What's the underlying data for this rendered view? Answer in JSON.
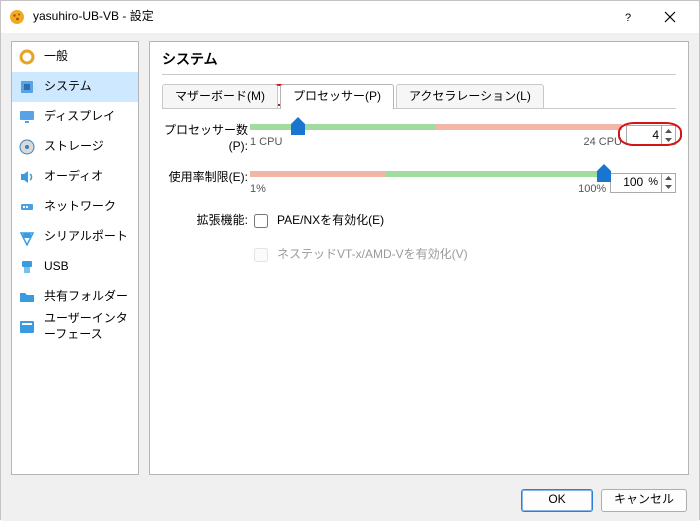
{
  "window": {
    "title": "yasuhiro-UB-VB - 設定"
  },
  "nav": {
    "items": [
      {
        "label": "一般",
        "icon": "gear"
      },
      {
        "label": "システム",
        "icon": "chip",
        "selected": true
      },
      {
        "label": "ディスプレイ",
        "icon": "monitor"
      },
      {
        "label": "ストレージ",
        "icon": "disk"
      },
      {
        "label": "オーディオ",
        "icon": "speaker"
      },
      {
        "label": "ネットワーク",
        "icon": "network"
      },
      {
        "label": "シリアルポート",
        "icon": "serial"
      },
      {
        "label": "USB",
        "icon": "usb"
      },
      {
        "label": "共有フォルダー",
        "icon": "folder"
      },
      {
        "label": "ユーザーインターフェース",
        "icon": "ui"
      }
    ]
  },
  "panel": {
    "title": "システム",
    "tabs": [
      {
        "label": "マザーボード(M)"
      },
      {
        "label": "プロセッサー(P)",
        "selected": true,
        "circled": true
      },
      {
        "label": "アクセラレーション(L)"
      }
    ],
    "rows": {
      "cpu_count": {
        "label": "プロセッサー数(P):",
        "min_label": "1 CPU",
        "max_label": "24 CPU",
        "value": 4,
        "min": 1,
        "max": 24,
        "green_end_pct": 50,
        "thumb_pct": 13,
        "spin_circled": true
      },
      "exec_cap": {
        "label": "使用率制限(E):",
        "min_label": "1%",
        "max_label": "100%",
        "value": 100,
        "unit": "%",
        "min": 1,
        "max": 100,
        "green_start_pct": 38,
        "thumb_pct": 100
      },
      "ext": {
        "label": "拡張機能:",
        "pae_label": "PAE/NXを有効化(E)",
        "pae_checked": false,
        "nested_label": "ネステッドVT-x/AMD-Vを有効化(V)",
        "nested_checked": false,
        "nested_disabled": true
      }
    }
  },
  "buttons": {
    "ok": "OK",
    "cancel": "キャンセル"
  },
  "colors": {
    "slider_green": "#a0dca0",
    "slider_red": "#f2b6a9",
    "thumb": "#1a75d1",
    "highlight": "#d11414"
  }
}
